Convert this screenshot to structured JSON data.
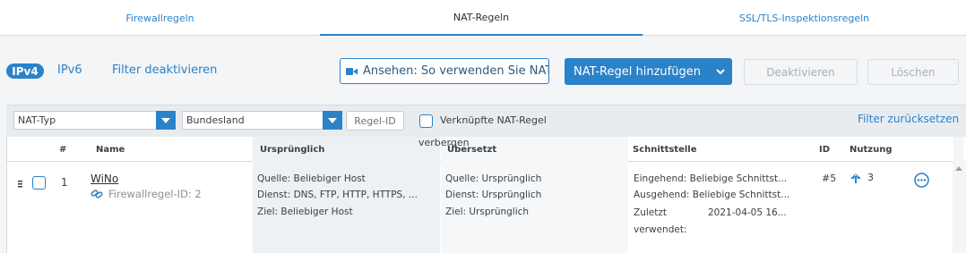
{
  "tabs": [
    "Firewallregeln",
    "NAT-Regeln",
    "SSL/TLS-Inspektionsregeln"
  ],
  "toolbar": {
    "ipv4": "IPv4",
    "ipv6": "IPv6",
    "filter_off": "Filter deaktivieren",
    "watch_label": "Ansehen: So verwenden Sie NAT",
    "add_label": "NAT-Regel hinzufügen",
    "deactivate_label": "Deaktivieren",
    "delete_label": "Löschen"
  },
  "filters": {
    "nat_type": "NAT-Typ",
    "region": "Bundesland",
    "rule_id": "Regel-ID",
    "linked_rule": "Verknüpfte NAT-Regel",
    "reset": "Filter zurücksetzen",
    "hidden": "verbergen"
  },
  "table": {
    "headers": [
      "#",
      "Name",
      "Ursprünglich",
      "Übersetzt",
      "Schnittstelle",
      "ID",
      "Nutzung"
    ],
    "row": {
      "num": "1",
      "name": "WiNo",
      "firewall_id": "Firewallregel-ID: 2",
      "original": [
        "Quelle: Beliebiger Host",
        "Dienst: DNS, FTP, HTTP, HTTPS, ...",
        "Ziel: Beliebiger Host"
      ],
      "translated": [
        "Quelle: Ursprünglich",
        "Dienst: Ursprünglich",
        "Ziel: Ursprünglich"
      ],
      "iface_in": "Eingehend: Beliebige Schnittst...",
      "iface_out": "Ausgehend: Beliebige Schnittst...",
      "last_used_label": "Zuletzt",
      "last_used_value": "2021-04-05 16...",
      "used_label": "verwendet:",
      "id": "#5",
      "usage": "3"
    }
  },
  "colors": {
    "accent": "#2a82c9"
  }
}
